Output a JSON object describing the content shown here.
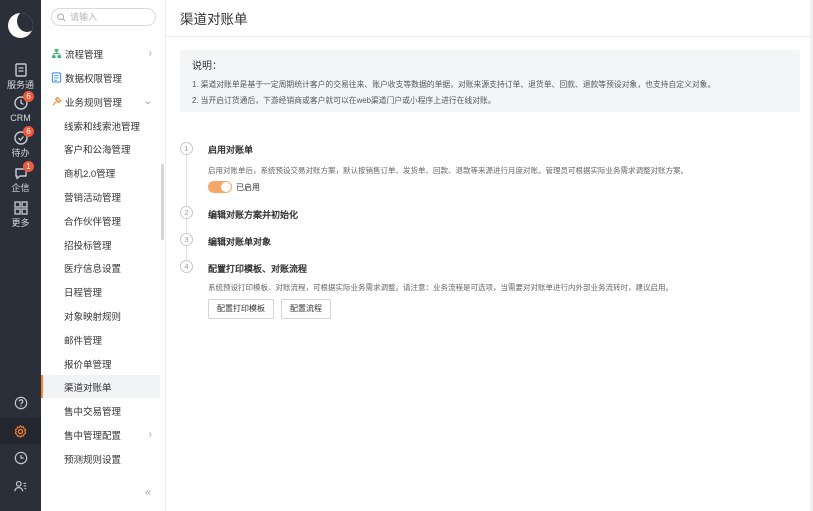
{
  "rail": {
    "items": [
      {
        "label": "服务通",
        "icon": "service-icon",
        "badge": ""
      },
      {
        "label": "CRM",
        "icon": "crm-clock-icon",
        "badge": "6"
      },
      {
        "label": "待办",
        "icon": "todo-icon",
        "badge": "6"
      },
      {
        "label": "企信",
        "icon": "chat-icon",
        "badge": "1"
      },
      {
        "label": "更多",
        "icon": "grid-icon",
        "badge": ""
      }
    ],
    "bottom": [
      "help-icon",
      "settings-icon",
      "history-icon",
      "contacts-icon"
    ]
  },
  "sidebar": {
    "search_placeholder": "请输入",
    "groups": [
      {
        "label": "流程管理",
        "icon": "flow-icon",
        "color": "#3fb67a"
      },
      {
        "label": "数据权限管理",
        "icon": "data-permission-icon",
        "color": "#4a90e2"
      },
      {
        "label": "业务规则管理",
        "icon": "rules-icon",
        "color": "#f48533"
      }
    ],
    "items": [
      "线索和线索池管理",
      "客户和公海管理",
      "商机2.0管理",
      "营销活动管理",
      "合作伙伴管理",
      "招投标管理",
      "医疗信息设置",
      "日程管理",
      "对象映射规则",
      "邮件管理",
      "报价单管理",
      "渠道对账单",
      "售中交易管理",
      "售中管理配置",
      "预测规则设置"
    ],
    "collapse": "«"
  },
  "main": {
    "title": "渠道对账单",
    "notice": {
      "title": "说明：",
      "lines": [
        "1. 渠道对账单是基于一定周期统计客户的交易往来、账户收支等数据的单据，对账来源支持订单、退货单、回款、退款等预设对象，也支持自定义对象。",
        "2. 当开启订货通后，下游经销商或客户就可以在web渠道门户或小程序上进行在线对账。"
      ]
    },
    "steps": [
      {
        "num": "1",
        "title": "启用对账单",
        "desc": "启用对账单后，系统预设交易对账方案，默认按销售订单、发货单、回款、退款等来源进行月度对账。管理员可根据实际业务需求调整对账方案。",
        "toggle_label": "已启用"
      },
      {
        "num": "2",
        "title": "编辑对账方案并初始化"
      },
      {
        "num": "3",
        "title": "编辑对账单对象"
      },
      {
        "num": "4",
        "title": "配置打印模板、对账流程",
        "desc": "系统预设打印模板、对账流程，可根据实际业务需求调整。请注意：业务流程是可选项，当需要对对账单进行内外部业务流转时，建议启用。",
        "buttons": [
          "配置打印模板",
          "配置流程"
        ]
      }
    ],
    "accent": "#f48533"
  }
}
